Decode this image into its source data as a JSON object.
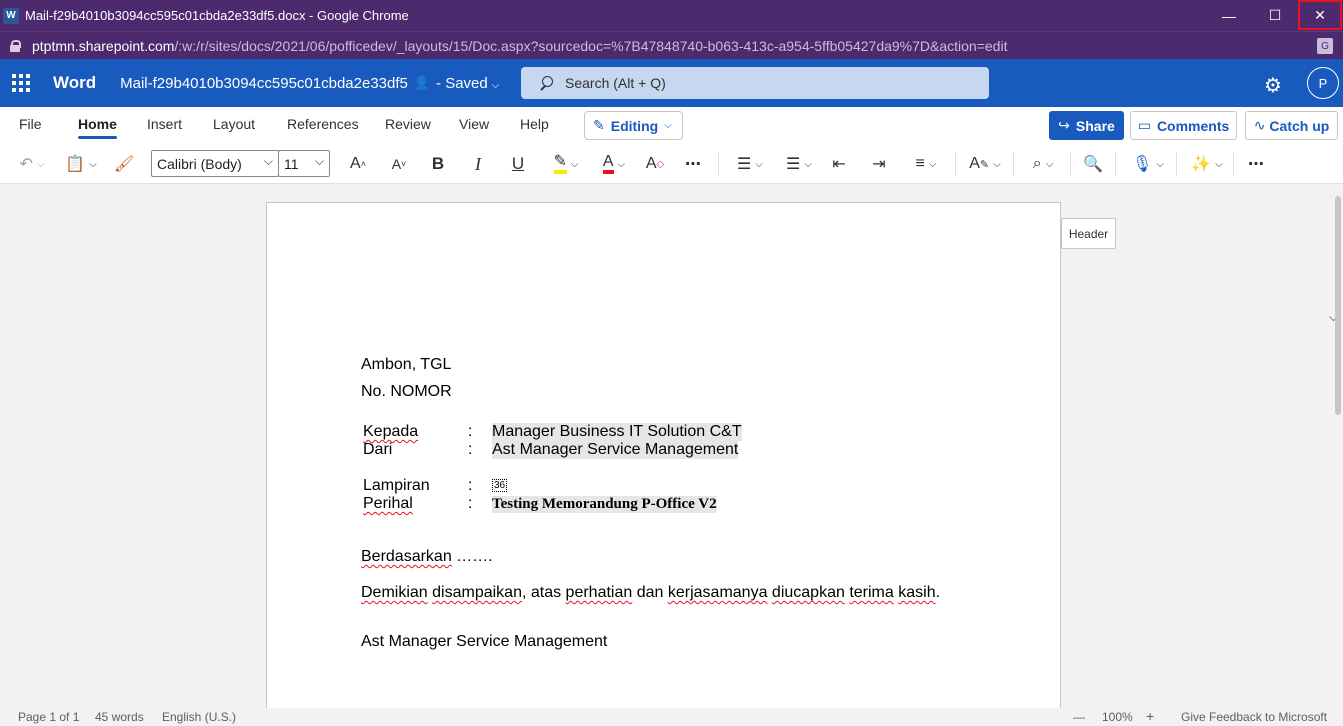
{
  "window": {
    "title": "Mail-f29b4010b3094cc595c01cbda2e33df5.docx - Google Chrome",
    "app_icon": "W",
    "minimize_glyph": "—",
    "maximize_glyph": "☐",
    "close_glyph": "✕"
  },
  "address": {
    "host": "ptptmn.sharepoint.com",
    "path": "/:w:/r/sites/docs/2021/06/pofficedev/_layouts/15/Doc.aspx?sourcedoc=%7B47848740-b063-413c-a954-5ffb05427da9%7D&action=edit"
  },
  "word": {
    "app_name": "Word",
    "doc_name": "Mail-f29b4010b3094cc595c01cbda2e33df5",
    "status": "- Saved",
    "search_placeholder": "Search (Alt + Q)",
    "avatar_initial": "P"
  },
  "ribbon": {
    "tabs": [
      "File",
      "Home",
      "Insert",
      "Layout",
      "References",
      "Review",
      "View",
      "Help"
    ],
    "active_tab": "Home",
    "mode": "Editing",
    "share": "Share",
    "comments": "Comments",
    "catchup": "Catch up"
  },
  "toolbar": {
    "font_name": "Calibri (Body)",
    "font_size": "11"
  },
  "document": {
    "line1": "Ambon,  TGL",
    "line2": "No.  NOMOR",
    "kepada_label": "Kepada",
    "kepada_value": "Manager Business IT Solution C&T",
    "dari_label": "Dari",
    "dari_value": "Ast Manager Service Management",
    "lampiran_label": "Lampiran",
    "lampiran_value": "36",
    "perihal_label": "Perihal",
    "perihal_value": "Testing Memorandung P-Office V2",
    "colon": ":",
    "berdasarkan": "Berdasarkan",
    "berdasarkan_dots": " …….",
    "closing_words": [
      "Demikian",
      " ",
      "disampaikan",
      ", atas ",
      "perhatian",
      " dan ",
      "kerjasamanya",
      " ",
      "diucapkan",
      " ",
      "terima",
      " ",
      "kasih",
      "."
    ],
    "signature": "Ast Manager Service Management"
  },
  "header_tag": "Header",
  "status_bar": {
    "page": "Page 1 of 1",
    "words": "45 words",
    "language": "English (U.S.)",
    "zoom_minus": "—",
    "zoom": "100%",
    "zoom_plus": "+",
    "feedback": "Give Feedback to Microsoft"
  }
}
